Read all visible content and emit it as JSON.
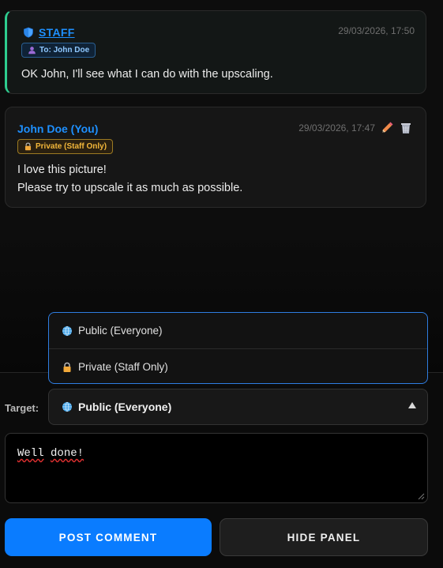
{
  "comments": [
    {
      "author": "STAFF",
      "timestamp": "29/03/2026, 17:50",
      "recipient_badge": "To: John Doe",
      "lines": [
        "OK John, I'll see what I can do with the upscaling."
      ]
    },
    {
      "author": "John Doe (You)",
      "timestamp": "29/03/2026, 17:47",
      "visibility_badge": "Private (Staff Only)",
      "lines": [
        "I love this picture!",
        "Please try to upscale it as much as possible."
      ]
    }
  ],
  "target": {
    "label": "Target:",
    "selected": "Public (Everyone)",
    "options": [
      "Public (Everyone)",
      "Private (Staff Only)"
    ]
  },
  "composer": {
    "value_words": [
      "Well",
      "done!"
    ]
  },
  "buttons": {
    "post": "POST COMMENT",
    "hide": "HIDE PANEL"
  },
  "colors": {
    "accent": "#0a7cff",
    "staff_border": "#2ecc8f",
    "author": "#1e90ff",
    "private_badge": "#f2b63a"
  }
}
